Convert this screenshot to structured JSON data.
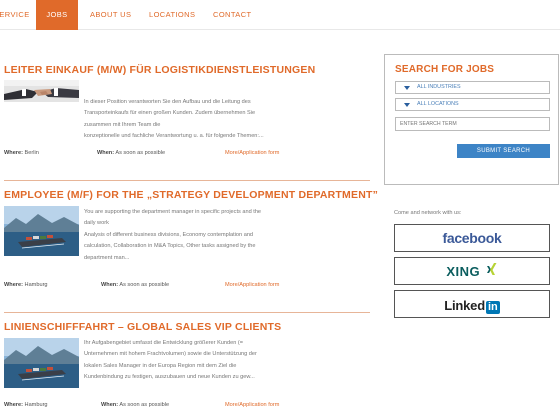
{
  "nav": {
    "items": [
      {
        "label": "SERVICE"
      },
      {
        "label": "JOBS",
        "active": true
      },
      {
        "label": "ABOUT US"
      },
      {
        "label": "LOCATIONS"
      },
      {
        "label": "CONTACT"
      }
    ]
  },
  "jobs": [
    {
      "title": "LEITER EINKAUF (M/W) FÜR LOGISTIKDIENSTLEISTUNGEN",
      "image": "handshake-photo",
      "desc_lines": [
        "In dieser Position verantworten Sie den Aufbau und die Leitung des",
        "Transporteinkaufs für einen großen Kunden. Zudem übernehmen Sie zusammen mit Ihrem Team die",
        "konzeptionelle und fachliche Verantwortung u. a. für folgende Themen:..."
      ],
      "where_label": "Where:",
      "where_value": "Berlin",
      "when_label": "When:",
      "when_value": "As soon as possible",
      "more": "More/Application form"
    },
    {
      "title": "EMPLOYEE (M/F) FOR THE „STRATEGY DEVELOPMENT DEPARTMENT”",
      "image": "container-ship-photo",
      "desc_lines": [
        "You are supporting the department manager in specific projects and the",
        "daily work",
        "Analysis of different business divisions, Economy contemplation and",
        "calculation, Collaboration in M&A Topics, Other tasks assigned by the",
        "department man..."
      ],
      "where_label": "Where:",
      "where_value": "Hamburg",
      "when_label": "When:",
      "when_value": "As soon as possible",
      "more": "More/Application form"
    },
    {
      "title": "LINIENSCHIFFFAHRT – GLOBAL SALES VIP CLIENTS",
      "image": "container-ship-photo",
      "desc_lines": [
        "Ihr Aufgabengebiet umfasst die Entwicklung größerer Kunden (=",
        "Unternehmen mit hohem Frachtvolumen) sowie die Unterstützung der",
        "lokalen Sales Manager in der Europa Region mit dem Ziel die",
        "Kundenbindung zu festigen, auszubauen und neue Kunden zu gew..."
      ],
      "where_label": "Where:",
      "where_value": "Hamburg",
      "when_label": "When:",
      "when_value": "As soon as possible",
      "more": "More/Application form"
    }
  ],
  "search": {
    "title": "SEARCH FOR JOBS",
    "industries": "ALL INDUSTRIES",
    "locations": "ALL LOCATIONS",
    "term_placeholder": "ENTER SEARCH TERM",
    "button": "SUBMIT SEARCH"
  },
  "social": {
    "intro": "Come and network with us:",
    "facebook": "facebook",
    "xing": "XING",
    "linkedin_text": "Linked",
    "linkedin_badge": "in"
  },
  "colors": {
    "accent": "#e06a2a",
    "button": "#3d84c6",
    "facebook": "#3b5998",
    "xing": "#0a5d5e",
    "linkedin": "#0077b5"
  }
}
